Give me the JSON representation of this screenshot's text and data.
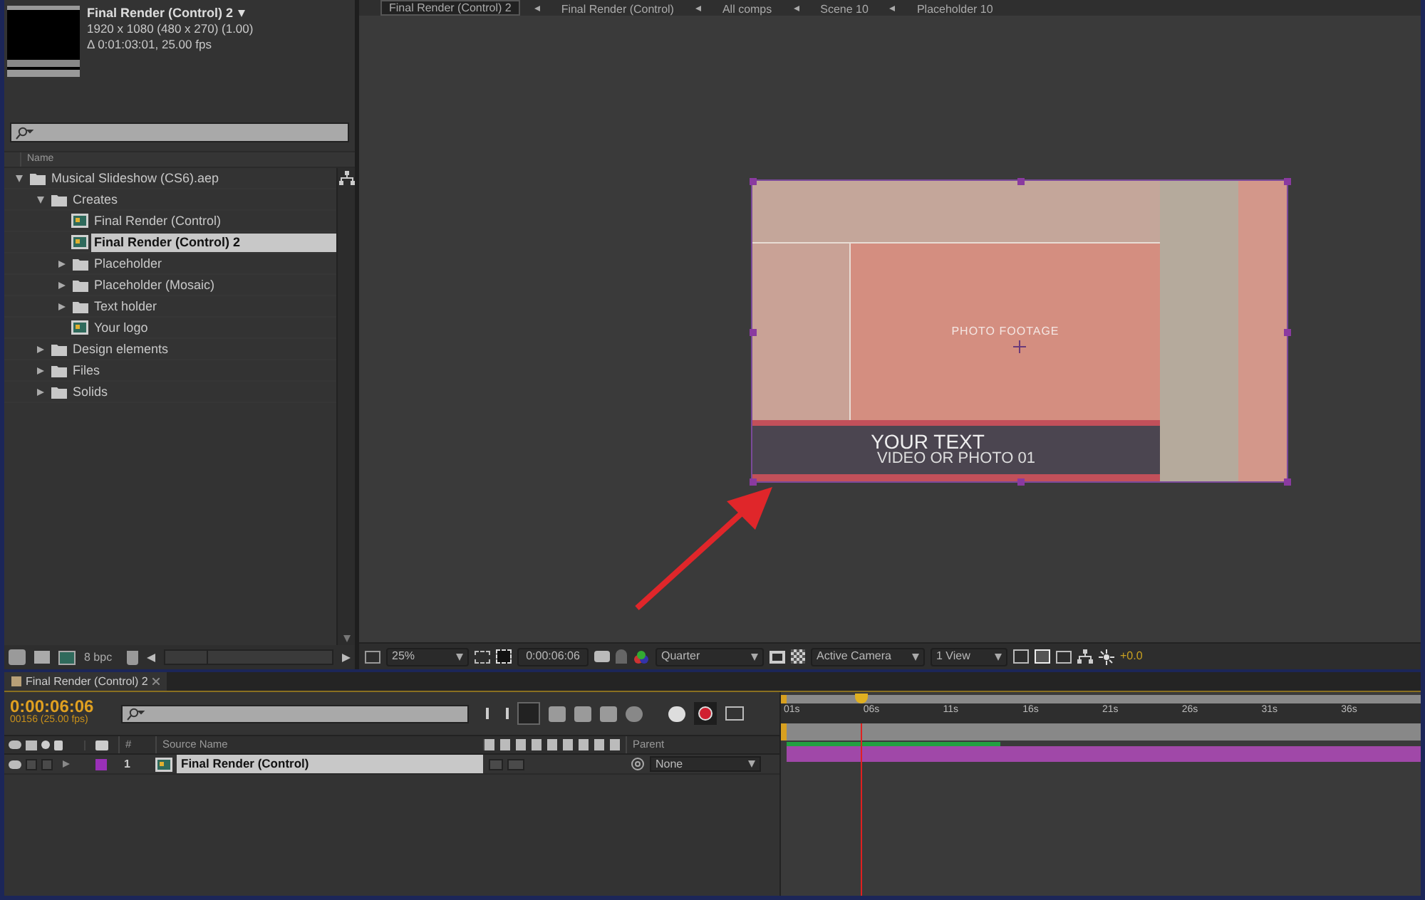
{
  "project_panel": {
    "preview": {
      "title": "Final Render (Control) 2",
      "dimensions": "1920 x 1080  (480 x 270) (1.00)",
      "duration": "Δ 0:01:03:01, 25.00 fps"
    },
    "column": "Name",
    "tree": [
      {
        "label": "Musical Slideshow (CS6).aep",
        "kind": "folder",
        "expanded": true,
        "selected": false,
        "children": [
          {
            "label": "Creates",
            "kind": "folder",
            "expanded": true,
            "selected": false,
            "children": [
              {
                "label": "Final Render (Control)",
                "kind": "comp",
                "selected": false
              },
              {
                "label": "Final Render (Control) 2",
                "kind": "comp",
                "selected": true
              },
              {
                "label": "Placeholder",
                "kind": "folder",
                "expanded": false,
                "selected": false
              },
              {
                "label": "Placeholder (Mosaic)",
                "kind": "folder",
                "expanded": false,
                "selected": false
              },
              {
                "label": "Text holder",
                "kind": "folder",
                "expanded": false,
                "selected": false
              },
              {
                "label": "Your logo",
                "kind": "comp",
                "selected": false
              }
            ]
          },
          {
            "label": "Design elements",
            "kind": "folder",
            "expanded": false,
            "selected": false
          },
          {
            "label": "Files",
            "kind": "folder",
            "expanded": false,
            "selected": false
          },
          {
            "label": "Solids",
            "kind": "folder",
            "expanded": false,
            "selected": false
          }
        ]
      }
    ],
    "bit_depth": "8 bpc"
  },
  "viewer": {
    "breadcrumbs": [
      {
        "label": "Final Render (Control) 2",
        "selected": true
      },
      {
        "label": "Final Render (Control)",
        "selected": false
      },
      {
        "label": "All comps",
        "selected": false
      },
      {
        "label": "Scene 10",
        "selected": false
      },
      {
        "label": "Placeholder 10",
        "selected": false
      }
    ],
    "composition": {
      "photo_label": "PHOTO FOOTAGE",
      "title": "YOUR TEXT",
      "subtitle": "VIDEO OR PHOTO 01"
    },
    "toolbar": {
      "zoom": "25%",
      "timecode": "0:00:06:06",
      "resolution": "Quarter",
      "camera": "Active Camera",
      "views": "1 View",
      "exposure": "+0.0"
    }
  },
  "timeline": {
    "tab": "Final Render (Control) 2",
    "timecode": "0:00:06:06",
    "frame": "00156 (25.00 fps)",
    "columns": {
      "number": "#",
      "source": "Source Name",
      "parent": "Parent"
    },
    "layers": [
      {
        "number": "1",
        "name": "Final Render (Control)",
        "parent": "None",
        "color": "#9a30b8",
        "selected": true
      }
    ],
    "ruler": [
      "01s",
      "06s",
      "11s",
      "16s",
      "21s",
      "26s",
      "31s",
      "36s"
    ]
  }
}
